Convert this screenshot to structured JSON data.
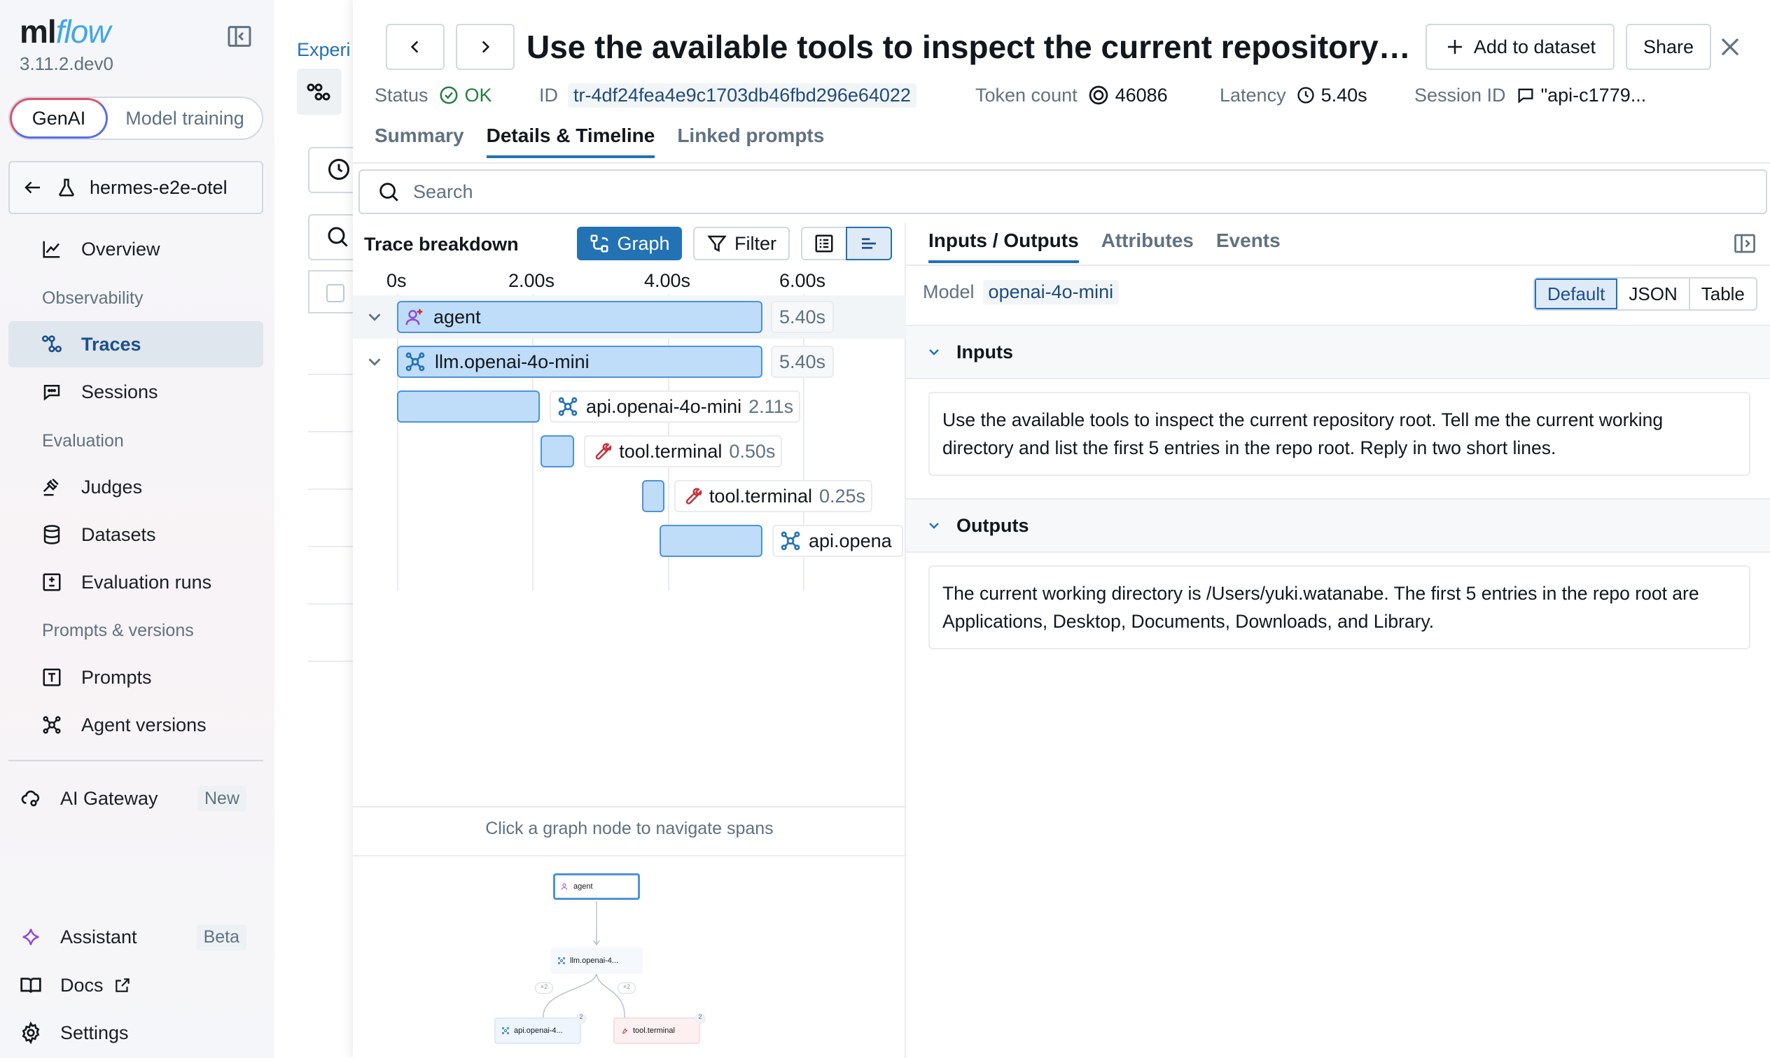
{
  "app": {
    "logo_text_a": "ml",
    "logo_text_b": "flow",
    "version": "3.11.2.dev0",
    "mode_genai": "GenAI",
    "mode_training": "Model training",
    "experiment_name": "hermes-e2e-otel"
  },
  "sidebar": {
    "overview": "Overview",
    "section_observability": "Observability",
    "traces": "Traces",
    "sessions": "Sessions",
    "section_evaluation": "Evaluation",
    "judges": "Judges",
    "datasets": "Datasets",
    "evaluation_runs": "Evaluation runs",
    "section_prompts": "Prompts & versions",
    "prompts": "Prompts",
    "agent_versions": "Agent versions",
    "ai_gateway": "AI Gateway",
    "ai_gateway_badge": "New",
    "assistant": "Assistant",
    "assistant_badge": "Beta",
    "docs": "Docs",
    "settings": "Settings"
  },
  "background_page": {
    "breadcrumb": "Experi"
  },
  "drawer": {
    "title": "Use the available tools to inspect the current repository root. Tell me the current working directory and list the first 5 entries in the repo root. Reply in two short lines.",
    "add_to_dataset": "Add to dataset",
    "share": "Share",
    "status_label": "Status",
    "status_value": "OK",
    "id_label": "ID",
    "id_value": "tr-4df24fea4e9c1703db46fbd296e64022",
    "token_label": "Token count",
    "token_value": "46086",
    "latency_label": "Latency",
    "latency_value": "5.40s",
    "session_label": "Session ID",
    "session_value": "\"api-c1779...",
    "tabs": [
      "Summary",
      "Details & Timeline",
      "Linked prompts"
    ],
    "search_placeholder": "Search"
  },
  "trace": {
    "title": "Trace breakdown",
    "graph_btn": "Graph",
    "filter_btn": "Filter",
    "axis_ticks": [
      "0s",
      "2.00s",
      "4.00s",
      "6.00s"
    ],
    "axis_max_s": 6.0,
    "spans": [
      {
        "name": "agent",
        "duration": "5.40s",
        "start": 0.0,
        "end": 5.4,
        "kind": "agent",
        "expandable": true
      },
      {
        "name": "llm.openai-4o-mini",
        "duration": "5.40s",
        "start": 0.0,
        "end": 5.4,
        "kind": "llm",
        "expandable": true
      },
      {
        "name": "api.openai-4o-mini",
        "duration": "2.11s",
        "start": 0.0,
        "end": 2.11,
        "kind": "llm",
        "expandable": false
      },
      {
        "name": "tool.terminal",
        "duration": "0.50s",
        "start": 2.12,
        "end": 2.62,
        "kind": "tool",
        "expandable": false
      },
      {
        "name": "tool.terminal",
        "duration": "0.25s",
        "start": 3.62,
        "end": 3.87,
        "kind": "tool",
        "expandable": false
      },
      {
        "name": "api.opena",
        "duration": "",
        "start": 3.88,
        "end": 5.4,
        "kind": "llm",
        "expandable": false
      }
    ],
    "graph_hint": "Click a graph node to navigate spans",
    "mini_graph": {
      "root": "agent",
      "child": "llm.openai-4...",
      "leaf_a": "api.openai-4...",
      "leaf_b": "tool.terminal",
      "edge_a": "×2",
      "edge_b": "×2",
      "count_a": "2",
      "count_b": "2"
    }
  },
  "detail": {
    "tabs": [
      "Inputs / Outputs",
      "Attributes",
      "Events"
    ],
    "model_label": "Model",
    "model_value": "openai-4o-mini",
    "view_modes": [
      "Default",
      "JSON",
      "Table"
    ],
    "inputs_title": "Inputs",
    "inputs_text": "Use the available tools to inspect the current repository root. Tell me the current working directory and list the first 5 entries in the repo root. Reply in two short lines.",
    "outputs_title": "Outputs",
    "outputs_text": "The current working directory is /Users/yuki.watanabe. The first 5 entries in the repo root are Applications, Desktop, Documents, Downloads, and Library."
  },
  "colors": {
    "accent": "#2272b4",
    "span_fill": "#bfdcf8",
    "span_border": "#4c93db",
    "ok_green": "#277c43",
    "tool_red": "#c4313b",
    "agent_purple": "#8e4bd8"
  }
}
